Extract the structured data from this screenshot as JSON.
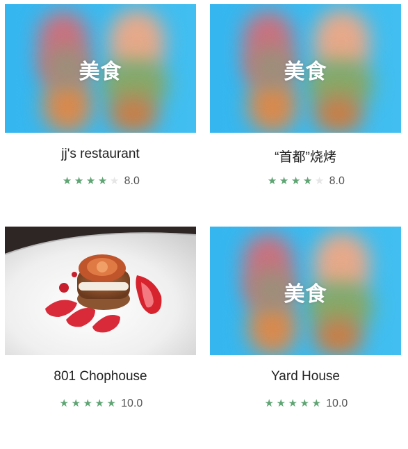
{
  "placeholder_label": "美食",
  "colors": {
    "star_on": "#5fa473",
    "star_off": "#e6e6e6",
    "placeholder_bg": "#3ab8ec"
  },
  "restaurants": [
    {
      "name": "jj's restaurant",
      "stars": 4,
      "score": "8.0",
      "image": "placeholder"
    },
    {
      "name": "“首都”烧烤",
      "stars": 4,
      "score": "8.0",
      "image": "placeholder"
    },
    {
      "name": "801 Chophouse",
      "stars": 5,
      "score": "10.0",
      "image": "dessert-photo"
    },
    {
      "name": "Yard House",
      "stars": 5,
      "score": "10.0",
      "image": "placeholder"
    }
  ]
}
